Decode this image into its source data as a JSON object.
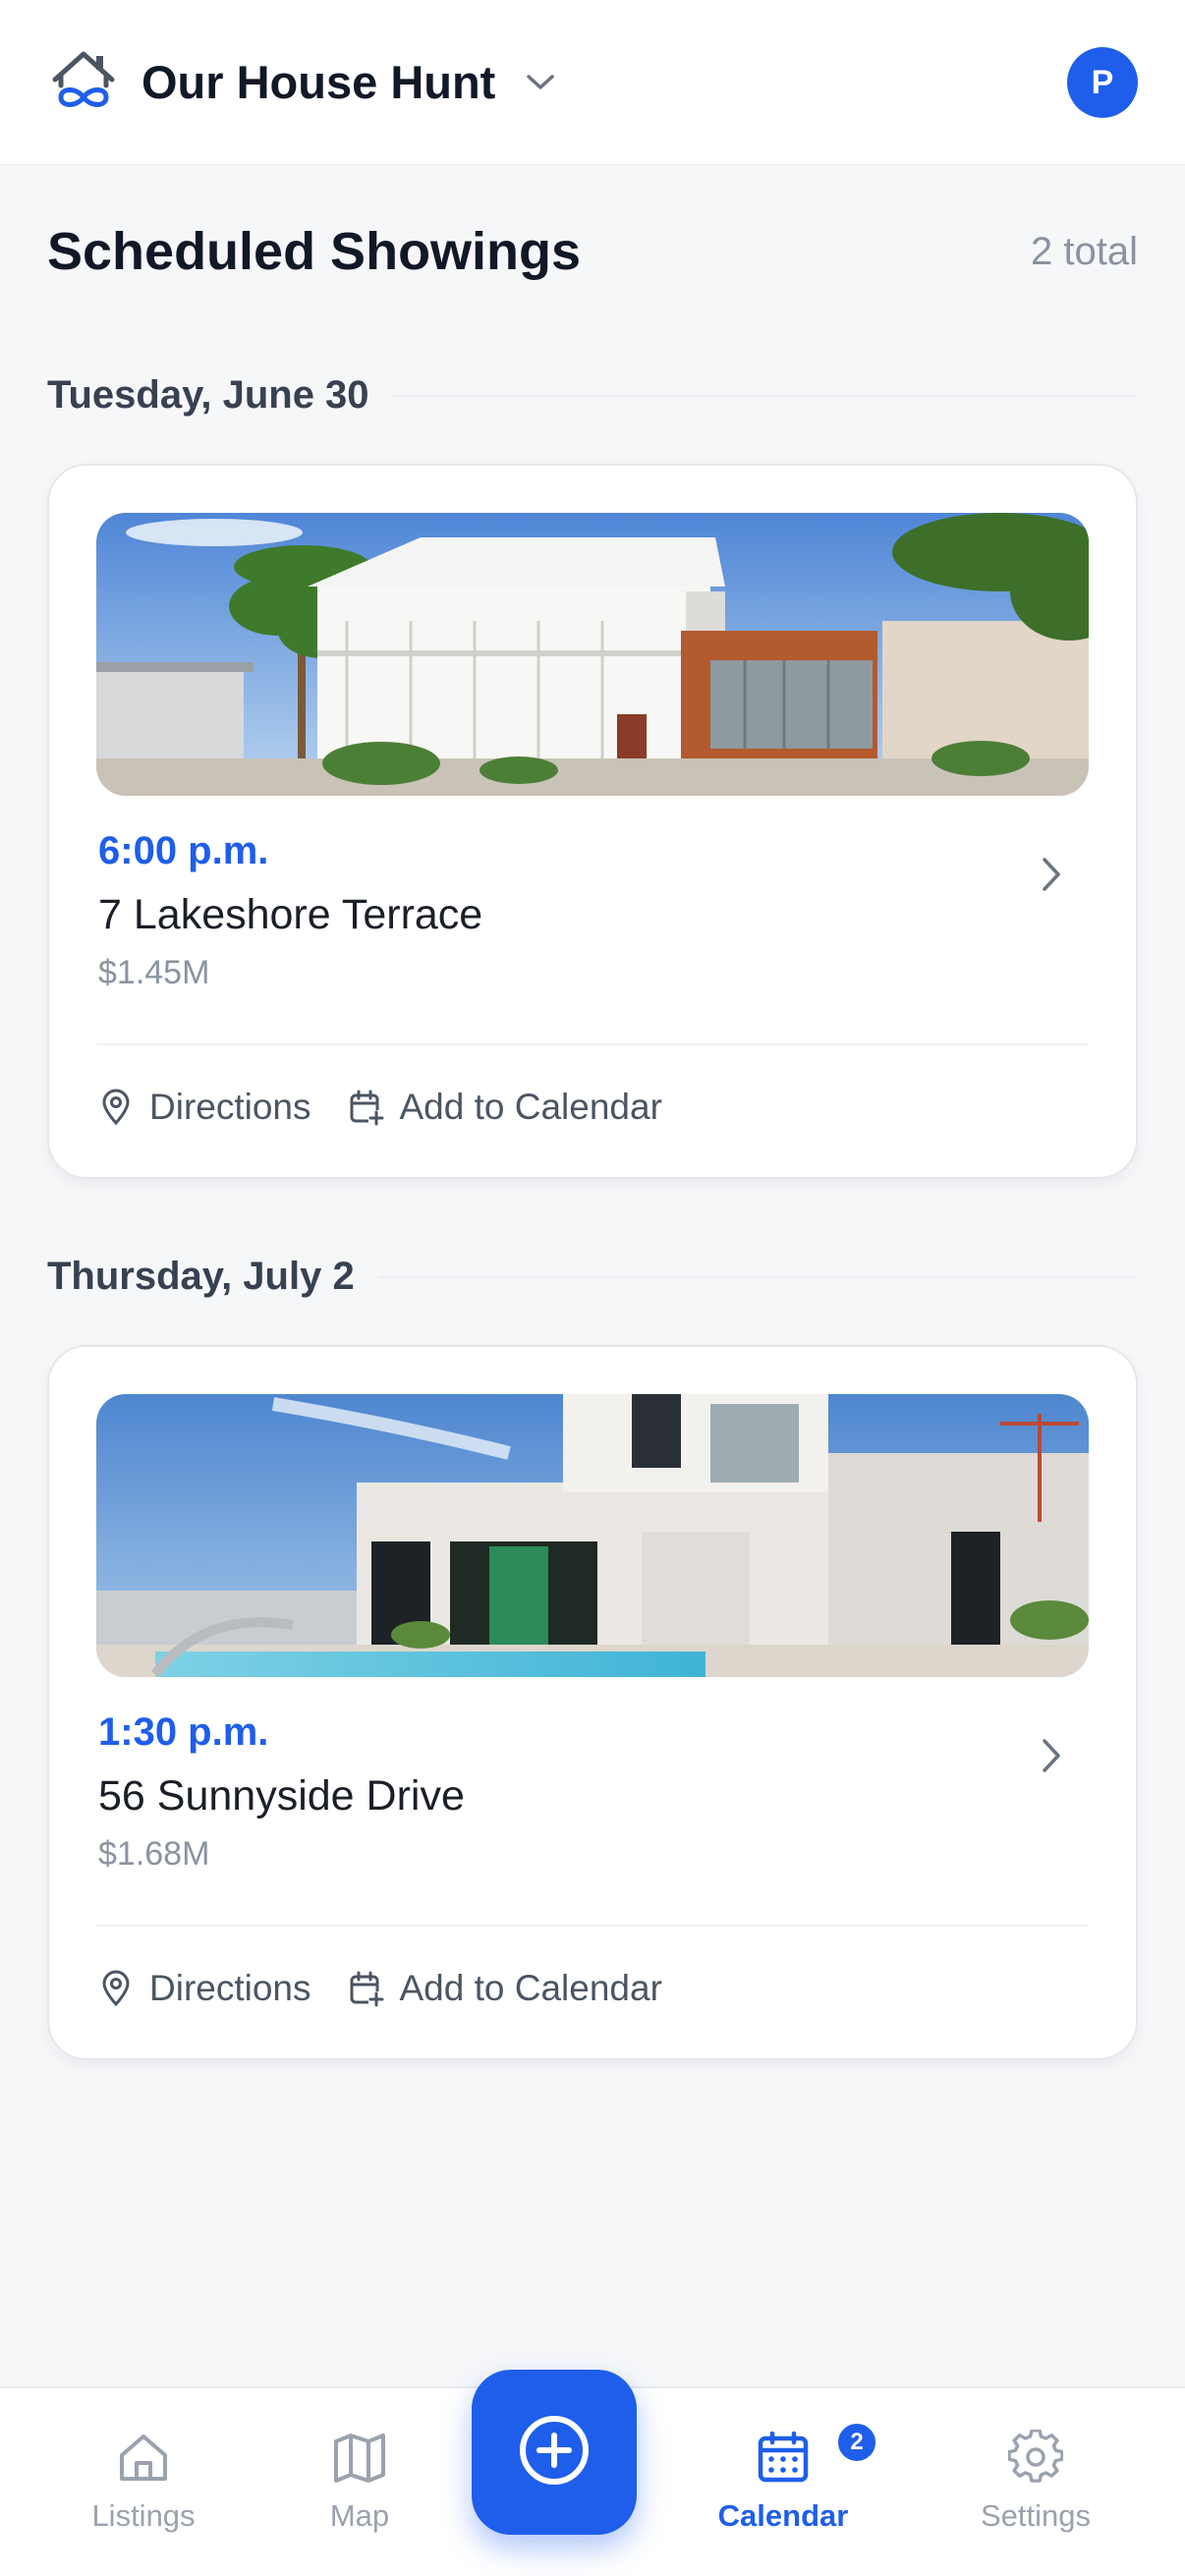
{
  "header": {
    "app_title": "Our House Hunt",
    "avatar_initial": "P",
    "logo_icon": "house-infinity-icon",
    "dropdown_icon": "chevron-down-icon"
  },
  "page": {
    "title": "Scheduled Showings",
    "total": "2 total"
  },
  "days": [
    {
      "label": "Tuesday, June 30",
      "showings": [
        {
          "time": "6:00 p.m.",
          "address": "7 Lakeshore Terrace",
          "price": "$1.45M",
          "directions_label": "Directions",
          "calendar_label": "Add to Calendar"
        }
      ]
    },
    {
      "label": "Thursday, July 2",
      "showings": [
        {
          "time": "1:30 p.m.",
          "address": "56 Sunnyside Drive",
          "price": "$1.68M",
          "directions_label": "Directions",
          "calendar_label": "Add to Calendar"
        }
      ]
    }
  ],
  "nav": {
    "listings": "Listings",
    "map": "Map",
    "calendar": "Calendar",
    "settings": "Settings",
    "calendar_badge": "2",
    "active": "calendar"
  },
  "colors": {
    "accent": "#1f5eea",
    "muted_text": "#8b93a1",
    "background": "#f6f7f9"
  }
}
